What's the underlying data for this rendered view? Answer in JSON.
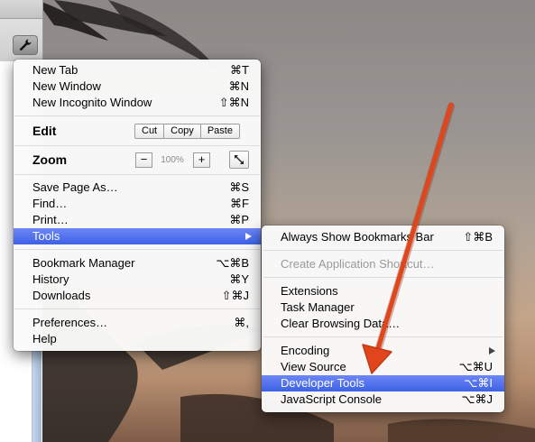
{
  "main_menu": {
    "group1": [
      {
        "label": "New Tab",
        "shortcut": "⌘T"
      },
      {
        "label": "New Window",
        "shortcut": "⌘N"
      },
      {
        "label": "New Incognito Window",
        "shortcut": "⇧⌘N"
      }
    ],
    "edit": {
      "label": "Edit",
      "cut": "Cut",
      "copy": "Copy",
      "paste": "Paste"
    },
    "zoom": {
      "label": "Zoom",
      "minus": "−",
      "value": "100%",
      "plus": "+"
    },
    "group2": [
      {
        "label": "Save Page As…",
        "shortcut": "⌘S"
      },
      {
        "label": "Find…",
        "shortcut": "⌘F"
      },
      {
        "label": "Print…",
        "shortcut": "⌘P"
      }
    ],
    "tools": {
      "label": "Tools"
    },
    "group3": [
      {
        "label": "Bookmark Manager",
        "shortcut": "⌥⌘B"
      },
      {
        "label": "History",
        "shortcut": "⌘Y"
      },
      {
        "label": "Downloads",
        "shortcut": "⇧⌘J"
      }
    ],
    "group4": [
      {
        "label": "Preferences…",
        "shortcut": "⌘,"
      },
      {
        "label": "Help",
        "shortcut": ""
      }
    ]
  },
  "tools_menu": {
    "items": [
      {
        "label": "Always Show Bookmarks Bar",
        "shortcut": "⇧⌘B"
      },
      {
        "label": "Create Application Shortcut…",
        "shortcut": ""
      },
      {
        "label": "Extensions",
        "shortcut": ""
      },
      {
        "label": "Task Manager",
        "shortcut": ""
      },
      {
        "label": "Clear Browsing Data…",
        "shortcut": ""
      },
      {
        "label": "Encoding",
        "shortcut": ""
      },
      {
        "label": "View Source",
        "shortcut": "⌥⌘U"
      },
      {
        "label": "Developer Tools",
        "shortcut": "⌥⌘I"
      },
      {
        "label": "JavaScript Console",
        "shortcut": "⌥⌘J"
      }
    ]
  },
  "icons": {
    "wrench": "wrench-icon",
    "fullscreen": "fullscreen-icon",
    "submenu_arrow": "chevron-right-icon"
  },
  "colors": {
    "highlight": "#3d62e6",
    "annotation_arrow": "#e0451b"
  }
}
